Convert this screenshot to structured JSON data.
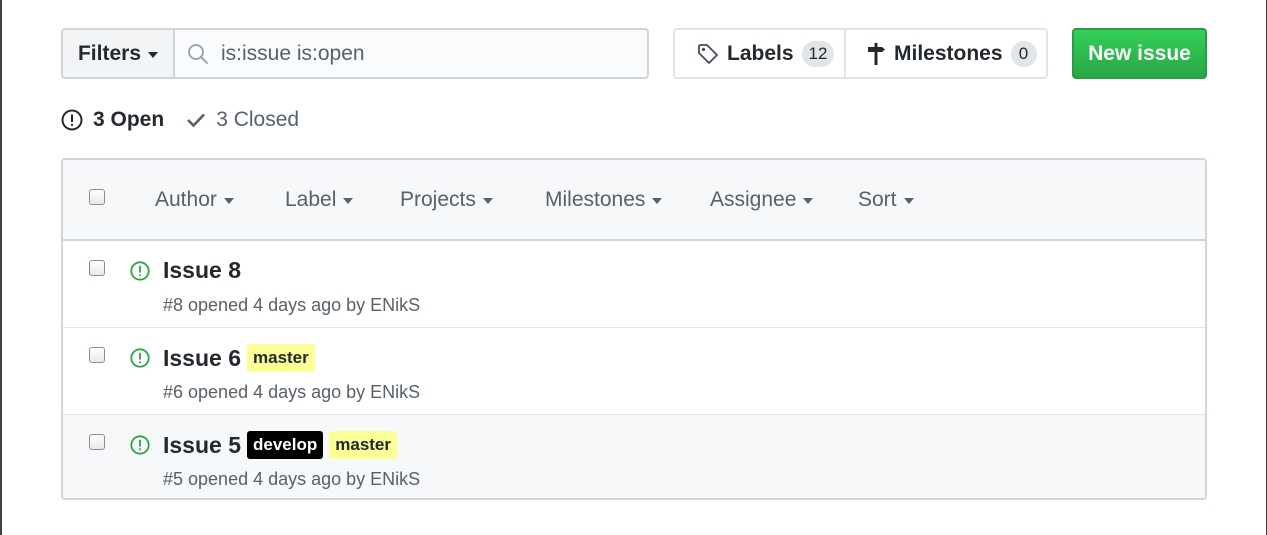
{
  "toolbar": {
    "filters_label": "Filters",
    "search_value": "is:issue is:open",
    "labels_label": "Labels",
    "labels_count": "12",
    "milestones_label": "Milestones",
    "milestones_count": "0",
    "new_issue_label": "New issue"
  },
  "states": {
    "open_label": "3 Open",
    "closed_label": "3 Closed"
  },
  "table": {
    "filters": [
      "Author",
      "Label",
      "Projects",
      "Milestones",
      "Assignee",
      "Sort"
    ],
    "issues": [
      {
        "title": "Issue 8",
        "meta": "#8 opened 4 days ago by ENikS",
        "labels": []
      },
      {
        "title": "Issue 6",
        "meta": "#6 opened 4 days ago by ENikS",
        "labels": [
          "master"
        ]
      },
      {
        "title": "Issue 5",
        "meta": "#5 opened 4 days ago by ENikS",
        "labels": [
          "develop",
          "master"
        ]
      }
    ]
  },
  "colors": {
    "accent_green": "#28a745",
    "label_master": "#fbff96",
    "label_develop": "#000000"
  }
}
